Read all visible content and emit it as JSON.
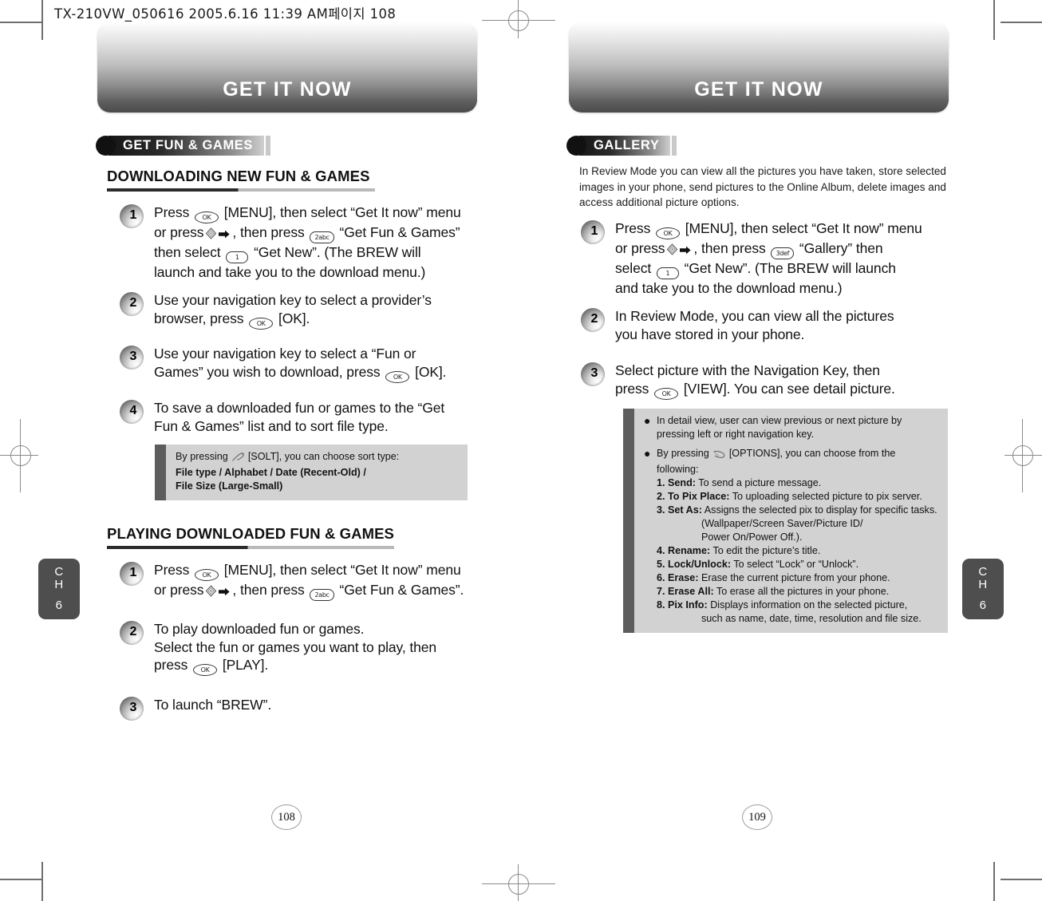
{
  "print_slug": "TX-210VW_050616  2005.6.16 11:39 AM페이지 108",
  "left_page": {
    "banner_title": "GET IT NOW",
    "section_label": "GET FUN & GAMES",
    "chapter_tab": {
      "ch": "C\nH",
      "ch_line1": "C",
      "ch_line2": "H",
      "number": "6"
    },
    "page_number": "108",
    "subsections": [
      {
        "heading": "DOWNLOADING NEW FUN & GAMES",
        "steps": [
          {
            "number": "1",
            "line1_a": "Press",
            "key1": "OK",
            "line1_b": "[MENU], then select “Get It now” menu",
            "line2_a": "or press",
            "line2_b": ", then press",
            "key2": "2abc",
            "line2_c": "“Get Fun & Games”",
            "line3_a": "then select",
            "key3": "1",
            "line3_b": "“Get New”. (The BREW will",
            "line4": "launch and take you to the download menu.)"
          },
          {
            "number": "2",
            "line1": "Use your navigation key to select a provider’s",
            "line2_a": "browser, press",
            "key1": "OK",
            "line2_b": "[OK]."
          },
          {
            "number": "3",
            "line1": "Use your navigation key to select a “Fun or",
            "line2_a": "Games” you wish to download, press",
            "key1": "OK",
            "line2_b": "[OK]."
          },
          {
            "number": "4",
            "line1": "To save a downloaded fun or games to the “Get",
            "line2": "Fun & Games” list and to sort file type."
          }
        ],
        "note": {
          "line1_a": "By pressing",
          "softkey": "soft-key",
          "line1_b": "[SOLT], you can choose sort type:",
          "line2": "File type / Alphabet / Date (Recent-Old) /",
          "line3": "File Size (Large-Small)"
        }
      },
      {
        "heading": "PLAYING DOWNLOADED FUN & GAMES",
        "steps": [
          {
            "number": "1",
            "line1_a": "Press",
            "key1": "OK",
            "line1_b": "[MENU], then select “Get It now” menu",
            "line2_a": "or press",
            "line2_b": ", then press",
            "key2": "2abc",
            "line2_c": "“Get Fun & Games”."
          },
          {
            "number": "2",
            "line1": "To play downloaded fun or games.",
            "line2": "Select the fun or games you want to play, then",
            "line3_a": "press",
            "key1": "OK",
            "line3_b": "[PLAY]."
          },
          {
            "number": "3",
            "line1": "To launch “BREW”."
          }
        ]
      }
    ]
  },
  "right_page": {
    "banner_title": "GET IT NOW",
    "section_label": "GALLERY",
    "chapter_tab": {
      "ch_line1": "C",
      "ch_line2": "H",
      "number": "6"
    },
    "page_number": "109",
    "intro": "In Review Mode you can view all the pictures you have taken, store selected images in your phone, send pictures to the Online Album, delete images and access additional picture options.",
    "steps": [
      {
        "number": "1",
        "line1_a": "Press",
        "key1": "OK",
        "line1_b": "[MENU], then select “Get It now” menu",
        "line2_a": "or press",
        "line2_b": ", then press",
        "key2": "3def",
        "line2_c": "“Gallery” then",
        "line3_a": "select",
        "key3": "1",
        "line3_b": "“Get New”. (The BREW will launch",
        "line4": "and take you to the download menu.)"
      },
      {
        "number": "2",
        "line1": "In Review Mode, you can view all the pictures",
        "line2": "you have stored in your phone."
      },
      {
        "number": "3",
        "line1": "Select picture with the Navigation Key, then",
        "line2_a": "press",
        "key1": "OK",
        "line2_b": "[VIEW]. You can see detail picture."
      }
    ],
    "note": {
      "bullet1_line1": "In detail view, user can view previous or next picture by",
      "bullet1_line2": "pressing left or right navigation key.",
      "bullet2_line1_a": "By pressing",
      "bullet2_softkey": "soft-key",
      "bullet2_line1_b": "[OPTIONS], you can choose from the following:",
      "options": [
        {
          "label": "1. Send:",
          "desc": "To send a picture message."
        },
        {
          "label": "2. To Pix Place:",
          "desc": "To uploading selected picture to pix server."
        },
        {
          "label": "3. Set As:",
          "desc": "Assigns the selected pix to display for specific tasks.",
          "sub1": "(Wallpaper/Screen Saver/Picture ID/",
          "sub2": "Power On/Power Off.)."
        },
        {
          "label": "4. Rename:",
          "desc": "To edit the picture’s title."
        },
        {
          "label": "5. Lock/Unlock:",
          "desc": "To select “Lock” or “Unlock”."
        },
        {
          "label": "6. Erase:",
          "desc": "Erase the current picture from your phone."
        },
        {
          "label": "7. Erase All:",
          "desc": "To erase all the pictures in your phone."
        },
        {
          "label": "8. Pix Info:",
          "desc": "Displays information on the selected picture,",
          "sub1": "such as name, date, time, resolution and file size."
        }
      ]
    }
  }
}
